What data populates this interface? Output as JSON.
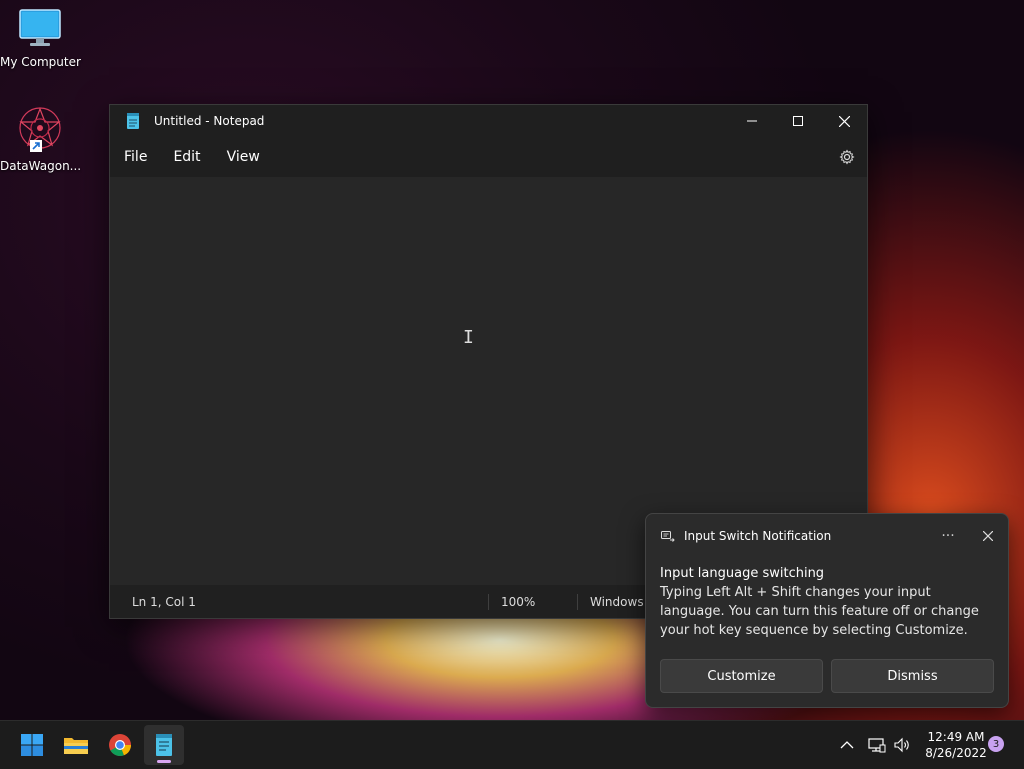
{
  "desktop": {
    "icons": [
      {
        "label": "My Computer",
        "icon": "monitor-icon"
      },
      {
        "label": "DataWagon...",
        "icon": "datawagon-shortcut-icon"
      }
    ]
  },
  "notepad": {
    "title": "Untitled - Notepad",
    "menu": [
      "File",
      "Edit",
      "View"
    ],
    "status": {
      "position": "Ln 1, Col 1",
      "zoom": "100%",
      "line_ending": "Windows ("
    }
  },
  "toast": {
    "app_name": "Input Switch Notification",
    "heading": "Input language switching",
    "body": "Typing Left Alt + Shift changes your input language. You can turn this feature off or change your hot key sequence by selecting Customize.",
    "more": "···",
    "buttons": {
      "customize": "Customize",
      "dismiss": "Dismiss"
    }
  },
  "taskbar": {
    "time": "12:49 AM",
    "date": "8/26/2022",
    "notification_count": "3"
  },
  "colors": {
    "taskbar_bg": "#1c1c1c",
    "window_bg": "#272727",
    "accent": "#d9a6f2"
  }
}
